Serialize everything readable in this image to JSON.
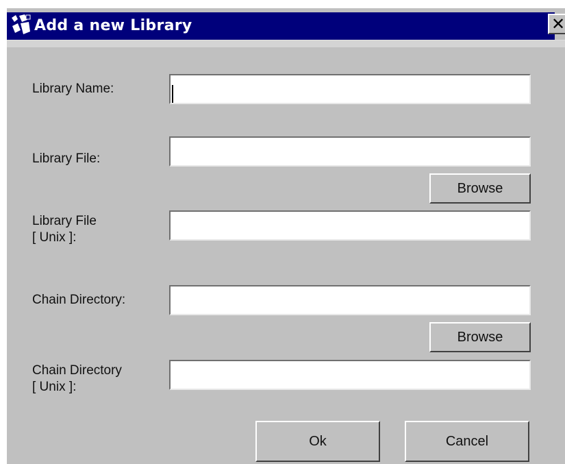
{
  "dialog": {
    "title": "Add a new Library",
    "close_glyph": "✕"
  },
  "fields": {
    "library_name": {
      "label": "Library Name:",
      "value": ""
    },
    "library_file": {
      "label": "Library File:",
      "value": ""
    },
    "library_file_unix": {
      "label_line1": "Library File",
      "label_line2": "[ Unix ]:",
      "value": ""
    },
    "chain_directory": {
      "label": "Chain Directory:",
      "value": ""
    },
    "chain_directory_unix": {
      "label_line1": "Chain Directory",
      "label_line2": "[ Unix ]:",
      "value": ""
    }
  },
  "buttons": {
    "browse_library_file": "Browse",
    "browse_chain_directory": "Browse",
    "ok": "Ok",
    "cancel": "Cancel"
  },
  "colors": {
    "titlebar": "#00007b",
    "dialog_background": "#c0c0c0",
    "title_text": "#ffffff"
  },
  "icons": {
    "title": "app-window-icon",
    "close": "close-icon"
  }
}
